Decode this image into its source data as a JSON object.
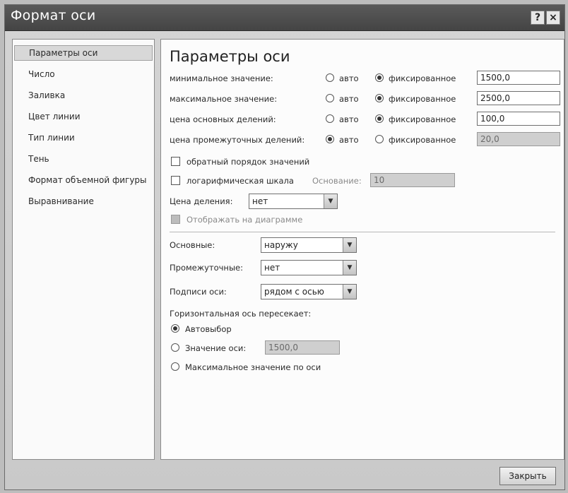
{
  "window": {
    "title": "Формат оси",
    "help_label": "?",
    "close_label": "×"
  },
  "nav": {
    "items": [
      {
        "label": "Параметры оси",
        "selected": true
      },
      {
        "label": "Число"
      },
      {
        "label": "Заливка"
      },
      {
        "label": "Цвет линии"
      },
      {
        "label": "Тип линии"
      },
      {
        "label": "Тень"
      },
      {
        "label": "Формат объемной фигуры"
      },
      {
        "label": "Выравнивание"
      }
    ]
  },
  "axis_options": {
    "heading": "Параметры оси",
    "auto_label": "авто",
    "fixed_label": "фиксированное",
    "rows": [
      {
        "label": "минимальное значение:",
        "mode": "fixed",
        "value": "1500,0"
      },
      {
        "label": "максимальное значение:",
        "mode": "fixed",
        "value": "2500,0"
      },
      {
        "label": "цена основных делений:",
        "mode": "fixed",
        "value": "100,0"
      },
      {
        "label": "цена промежуточных делений:",
        "mode": "auto",
        "value": "20,0"
      }
    ],
    "reverse_order": {
      "label": "обратный порядок значений",
      "checked": false
    },
    "log_scale": {
      "label": "логарифмическая шкала",
      "base_label": "Основание:",
      "base_value": "10",
      "checked": false
    },
    "display_units": {
      "label": "Цена деления:",
      "value": "нет"
    },
    "show_on_chart": {
      "label": "Отображать на диаграмме"
    },
    "major_ticks": {
      "label": "Основные:",
      "value": "наружу"
    },
    "minor_ticks": {
      "label": "Промежуточные:",
      "value": "нет"
    },
    "axis_labels": {
      "label": "Подписи оси:",
      "value": "рядом с осью"
    },
    "crosses": {
      "label": "Горизонтальная ось пересекает:",
      "options": [
        {
          "label": "Автовыбор",
          "checked": true
        },
        {
          "label": "Значение оси:",
          "value": "1500,0",
          "checked": false
        },
        {
          "label": "Максимальное значение по оси",
          "checked": false
        }
      ]
    }
  },
  "footer": {
    "close_label": "Закрыть"
  }
}
